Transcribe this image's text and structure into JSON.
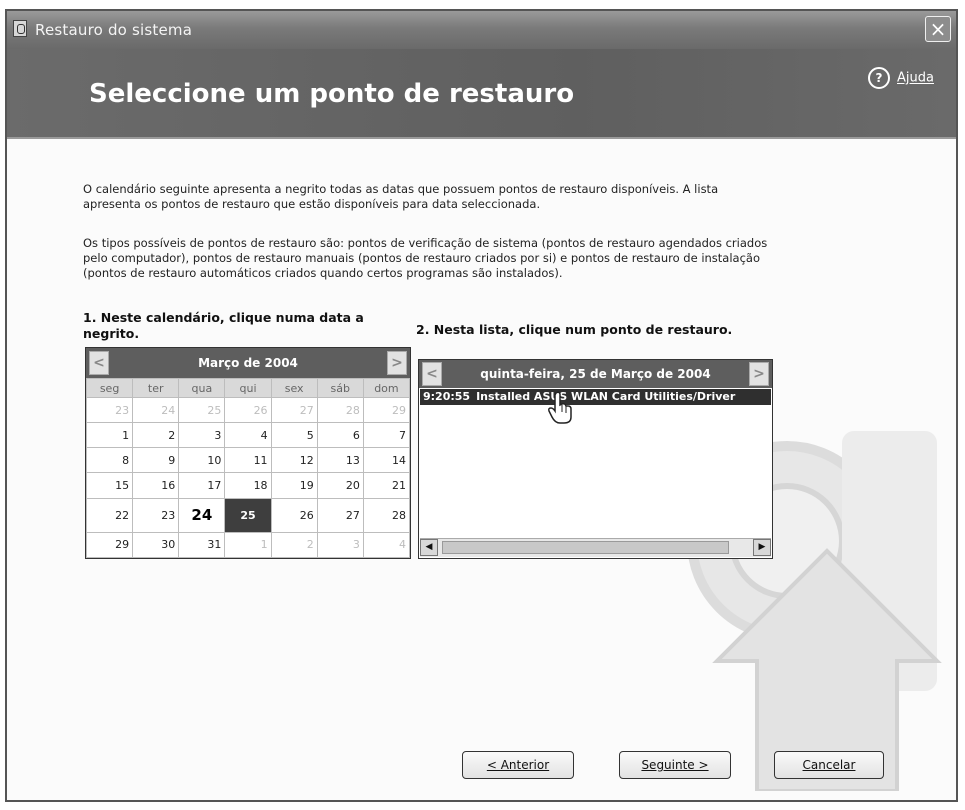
{
  "window": {
    "title": "Restauro do sistema",
    "close_label": "×"
  },
  "header": {
    "title": "Seleccione um ponto de restauro",
    "help_label": "Ajuda"
  },
  "intro": {
    "paragraph1": "O calendário seguinte apresenta a negrito todas as datas que possuem pontos de restauro disponíveis. A lista apresenta os pontos de restauro que estão disponíveis para data seleccionada.",
    "paragraph2": "Os tipos possíveis de pontos de restauro são: pontos de verificação de sistema (pontos de restauro agendados criados pelo computador), pontos de restauro manuais (pontos de restauro criados por si) e pontos de restauro de instalação (pontos de restauro automáticos criados quando certos programas são instalados)."
  },
  "calendar_section": {
    "label": "1. Neste calendário, clique numa data a negrito.",
    "month_label": "Março de 2004",
    "weekdays": [
      "seg",
      "ter",
      "qua",
      "qui",
      "sex",
      "sáb",
      "dom"
    ],
    "weeks": [
      [
        "23",
        "24",
        "25",
        "26",
        "27",
        "28",
        "29"
      ],
      [
        "1",
        "2",
        "3",
        "4",
        "5",
        "6",
        "7"
      ],
      [
        "8",
        "9",
        "10",
        "11",
        "12",
        "13",
        "14"
      ],
      [
        "15",
        "16",
        "17",
        "18",
        "19",
        "20",
        "21"
      ],
      [
        "22",
        "23",
        "24",
        "25",
        "26",
        "27",
        "28"
      ],
      [
        "29",
        "30",
        "31",
        "1",
        "2",
        "3",
        "4"
      ]
    ],
    "bold_day": "24",
    "selected_day": "25",
    "prev_label": "<",
    "next_label": ">"
  },
  "list_section": {
    "label": "2. Nesta lista, clique num ponto de restauro.",
    "date_label": "quinta-feira, 25 de Março de 2004",
    "prev_label": "<",
    "next_label": ">",
    "items": [
      {
        "time": "9:20:55",
        "description": "Installed ASUS WLAN Card Utilities/Driver"
      }
    ]
  },
  "buttons": {
    "back": "< Anterior",
    "next": "Seguinte >",
    "cancel": "Cancelar"
  }
}
